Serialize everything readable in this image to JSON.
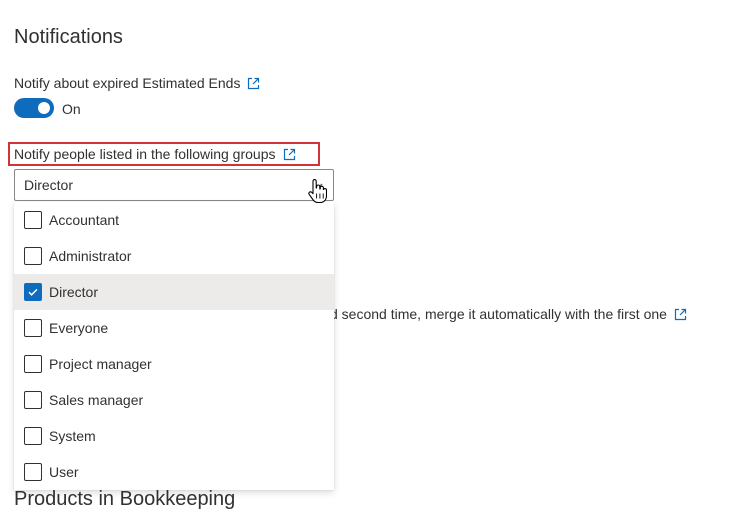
{
  "notifications": {
    "title": "Notifications",
    "expired_label": "Notify about expired Estimated Ends",
    "toggle_state": "On",
    "groups_label": "Notify people listed in the following groups",
    "selected_value": "Director",
    "merge_text": "d second time, merge it automatically with the first one"
  },
  "dropdown": {
    "options": [
      {
        "label": "Accountant",
        "checked": false
      },
      {
        "label": "Administrator",
        "checked": false
      },
      {
        "label": "Director",
        "checked": true
      },
      {
        "label": "Everyone",
        "checked": false
      },
      {
        "label": "Project manager",
        "checked": false
      },
      {
        "label": "Sales manager",
        "checked": false
      },
      {
        "label": "System",
        "checked": false
      },
      {
        "label": "User",
        "checked": false
      }
    ]
  },
  "products": {
    "title": "Products in Bookkeeping"
  },
  "colors": {
    "accent": "#0f6cbd",
    "highlight": "#d13438",
    "selected_row": "#edebe9"
  },
  "icons": {
    "external_link": "external-link-icon",
    "chevron": "chevron-down-icon",
    "cursor": "hand-cursor-icon",
    "check": "checkmark-icon"
  }
}
